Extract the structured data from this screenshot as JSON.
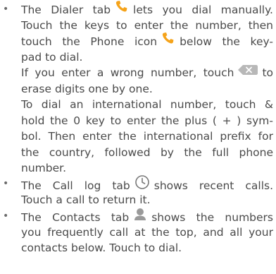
{
  "colors": {
    "text": "#4a4a4a",
    "phone_icon": "#f5a31a",
    "clock_icon": "#7a7a7a",
    "contact_icon": "#9a9a9a",
    "delete_key": "#b8b8b8"
  },
  "icons": {
    "phone": "phone-handset-icon",
    "clock": "clock-icon",
    "contact": "person-icon",
    "delete": "backspace-icon"
  },
  "bullet_char": "•",
  "dialer": {
    "l1a": "The Dialer tab",
    "l1b": "lets you dial manually.",
    "l2": "Touch the keys to enter the number, then",
    "l3a": "touch the Phone icon",
    "l3b": "below the key-",
    "l4": "pad to dial.",
    "l5a": "If you enter a wrong number, touch",
    "l5b": "to",
    "l6": "erase digits one by one.",
    "l7": "To dial an international number, touch &",
    "l8": "hold the 0 key to enter the plus ( + ) sym-",
    "l9": "bol. Then enter the international prefix for",
    "l10": "the country, followed by the full phone",
    "l11": "number."
  },
  "calllog": {
    "l1a": "The Call log tab",
    "l1b": "shows recent calls.",
    "l2": "Touch a call to return it."
  },
  "contacts": {
    "l1a": "The Contacts tab",
    "l1b": "shows the numbers",
    "l2": "you frequently call at the top, and all your",
    "l3": "contacts below. Touch to dial."
  }
}
